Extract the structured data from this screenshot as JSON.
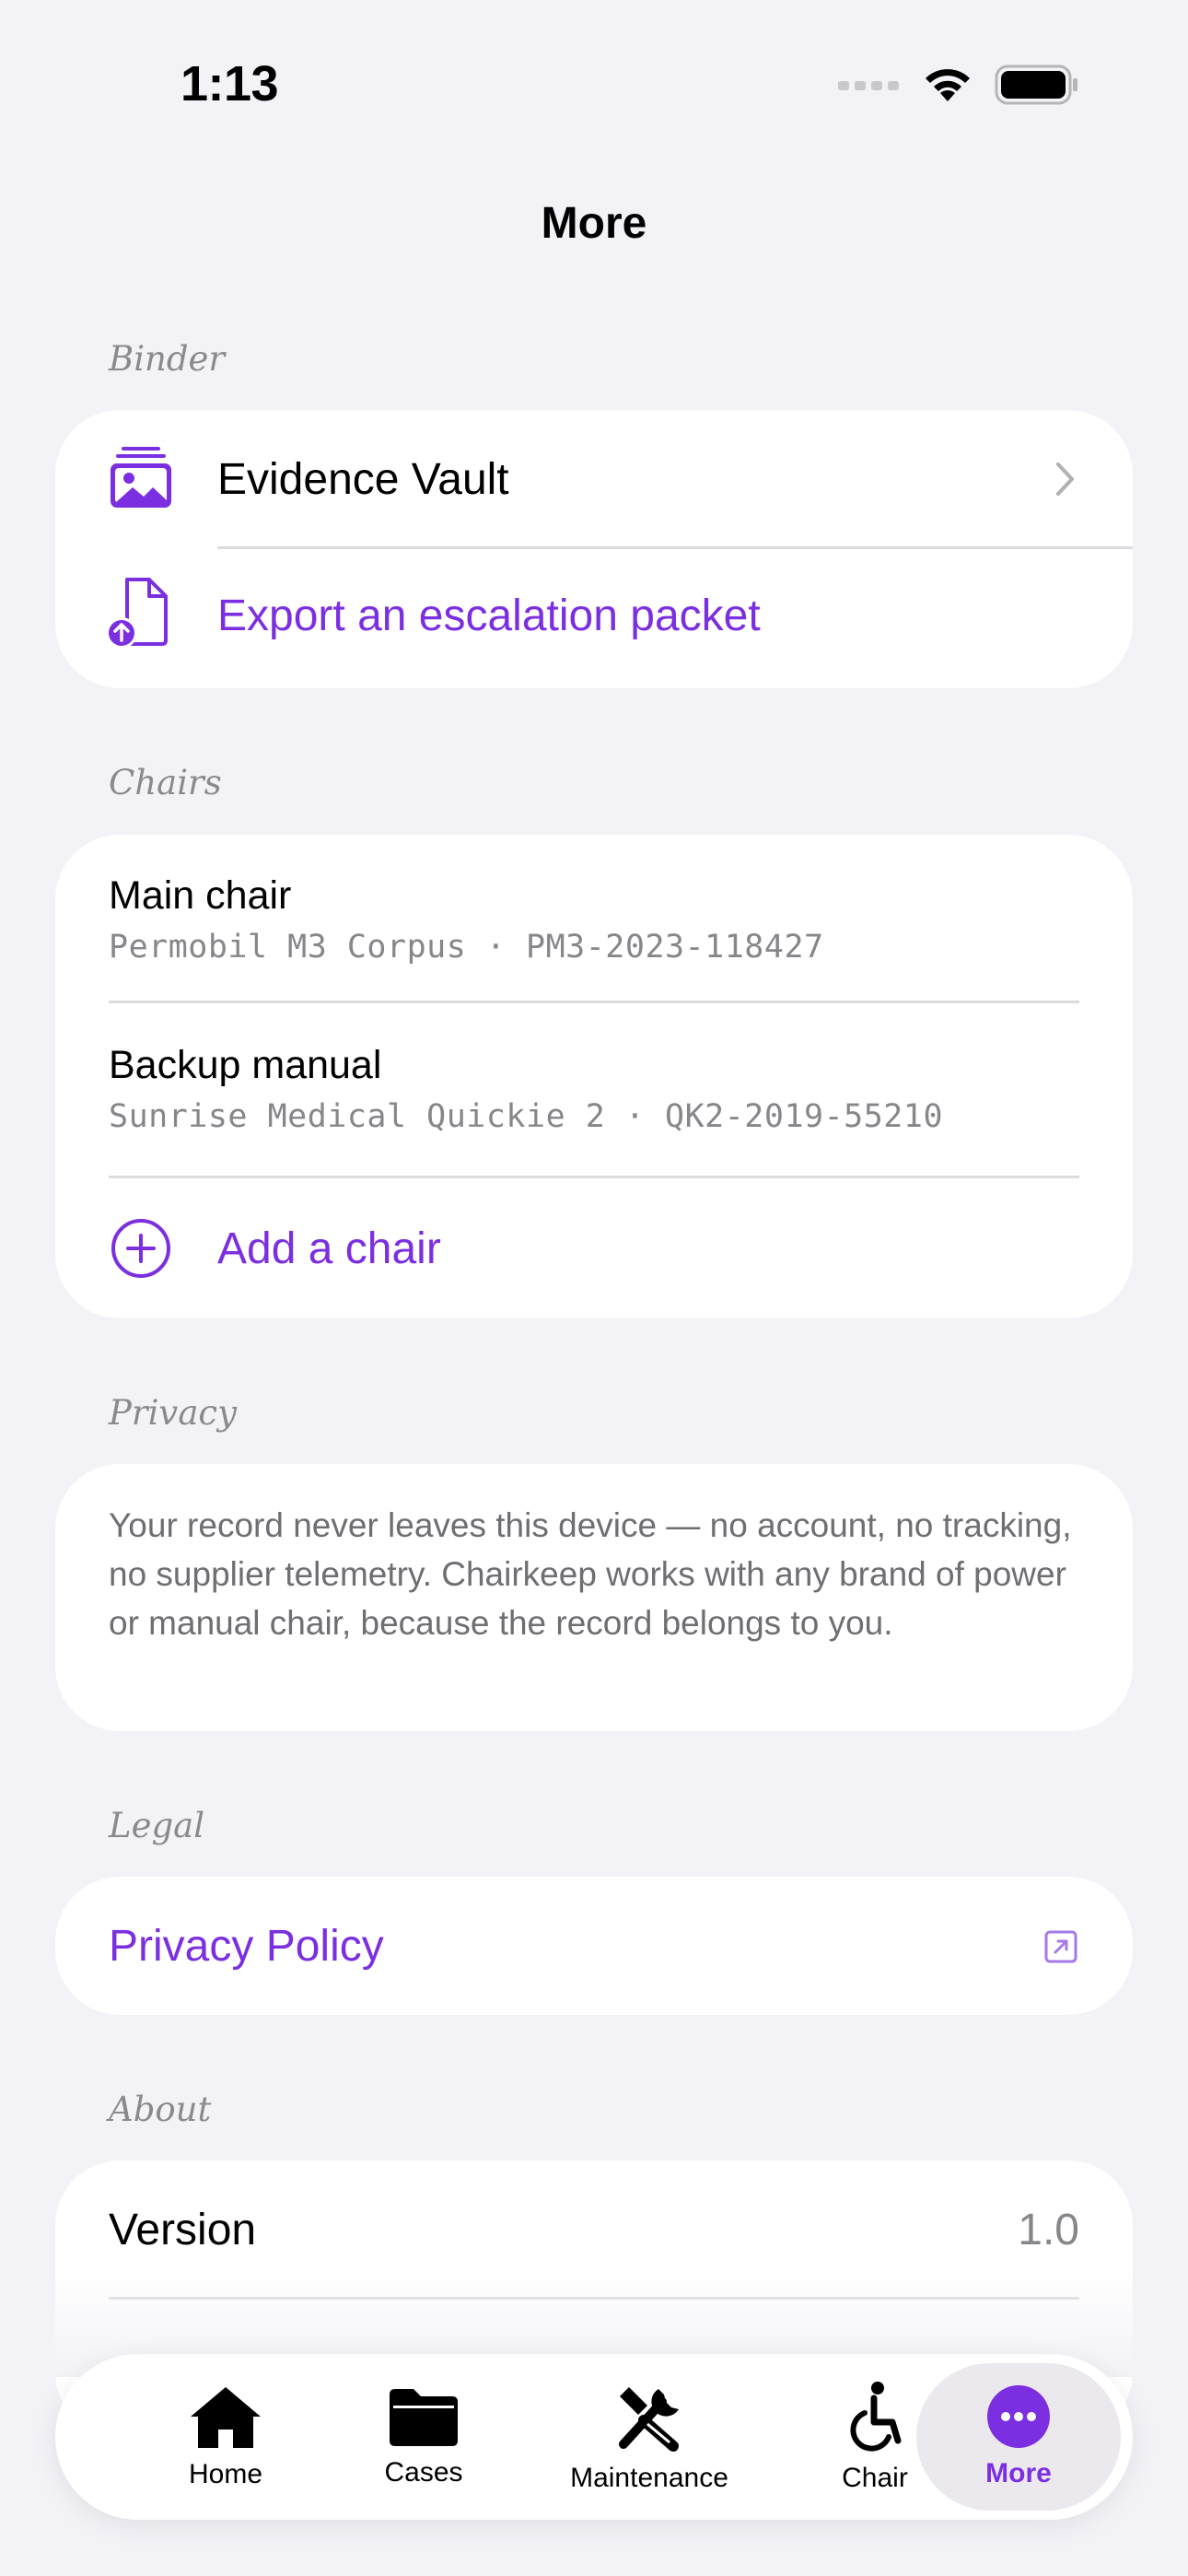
{
  "status_bar": {
    "time": "1:13"
  },
  "nav": {
    "title": "More"
  },
  "sections": {
    "binder": {
      "header": "Binder",
      "evidence_vault": "Evidence Vault",
      "export_packet": "Export an escalation packet"
    },
    "chairs": {
      "header": "Chairs",
      "items": [
        {
          "name": "Main chair",
          "detail": "Permobil M3 Corpus · PM3-2023-118427"
        },
        {
          "name": "Backup manual",
          "detail": "Sunrise Medical Quickie 2 · QK2-2019-55210"
        }
      ],
      "add_label": "Add a chair"
    },
    "privacy": {
      "header": "Privacy",
      "text": "Your record never leaves this device — no account, no tracking, no supplier telemetry. Chairkeep works with any brand of power or manual chair, because the record belongs to you."
    },
    "legal": {
      "header": "Legal",
      "privacy_policy": "Privacy Policy"
    },
    "about": {
      "header": "About",
      "version_label": "Version",
      "version_value": "1.0"
    }
  },
  "tab_bar": {
    "tabs": [
      {
        "label": "Home",
        "icon": "home-icon"
      },
      {
        "label": "Cases",
        "icon": "folder-icon"
      },
      {
        "label": "Maintenance",
        "icon": "tools-icon"
      },
      {
        "label": "Chair",
        "icon": "wheelchair-icon"
      },
      {
        "label": "More",
        "icon": "more-icon"
      }
    ],
    "active": "More"
  },
  "colors": {
    "accent": "#7b2fe0",
    "background": "#f2f2f7",
    "secondary_text": "#86868b"
  }
}
